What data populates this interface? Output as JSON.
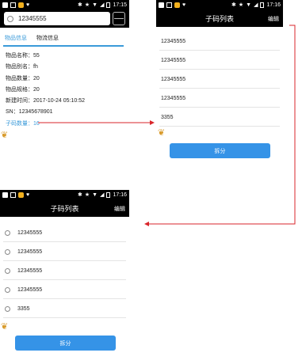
{
  "status_bars": {
    "screen1_time": "17:15",
    "screen2_time": "17:16",
    "screen3_time": "17:16",
    "icons": [
      "notification-icon",
      "image-icon",
      "app-icon",
      "lightbulb-icon",
      "bluetooth-icon",
      "star-icon",
      "wifi-icon",
      "signal-icon",
      "battery-icon"
    ]
  },
  "screen1": {
    "search": {
      "value": "12345555"
    },
    "tabs": [
      "物品信息",
      "物流信息"
    ],
    "details": [
      "物品名称：55",
      "物品别名：fh",
      "物品数量：20",
      "物品规格：20",
      "新建时间：2017-10-24 05:10:52",
      "SN：12345678901"
    ],
    "child_count_link": "子码数量：16"
  },
  "screen2": {
    "title": "子码列表",
    "edit": "编辑",
    "items": [
      "12345555",
      "12345555",
      "12345555",
      "12345555",
      "3355"
    ],
    "button": "拆分"
  },
  "screen3": {
    "title": "子码列表",
    "edit": "编辑",
    "items": [
      "12345555",
      "12345555",
      "12345555",
      "12345555",
      "3355"
    ],
    "button": "拆分"
  },
  "colors": {
    "accent": "#3a9ad9",
    "button": "#3593e7",
    "arrow": "#d9262b",
    "header": "#000000"
  }
}
